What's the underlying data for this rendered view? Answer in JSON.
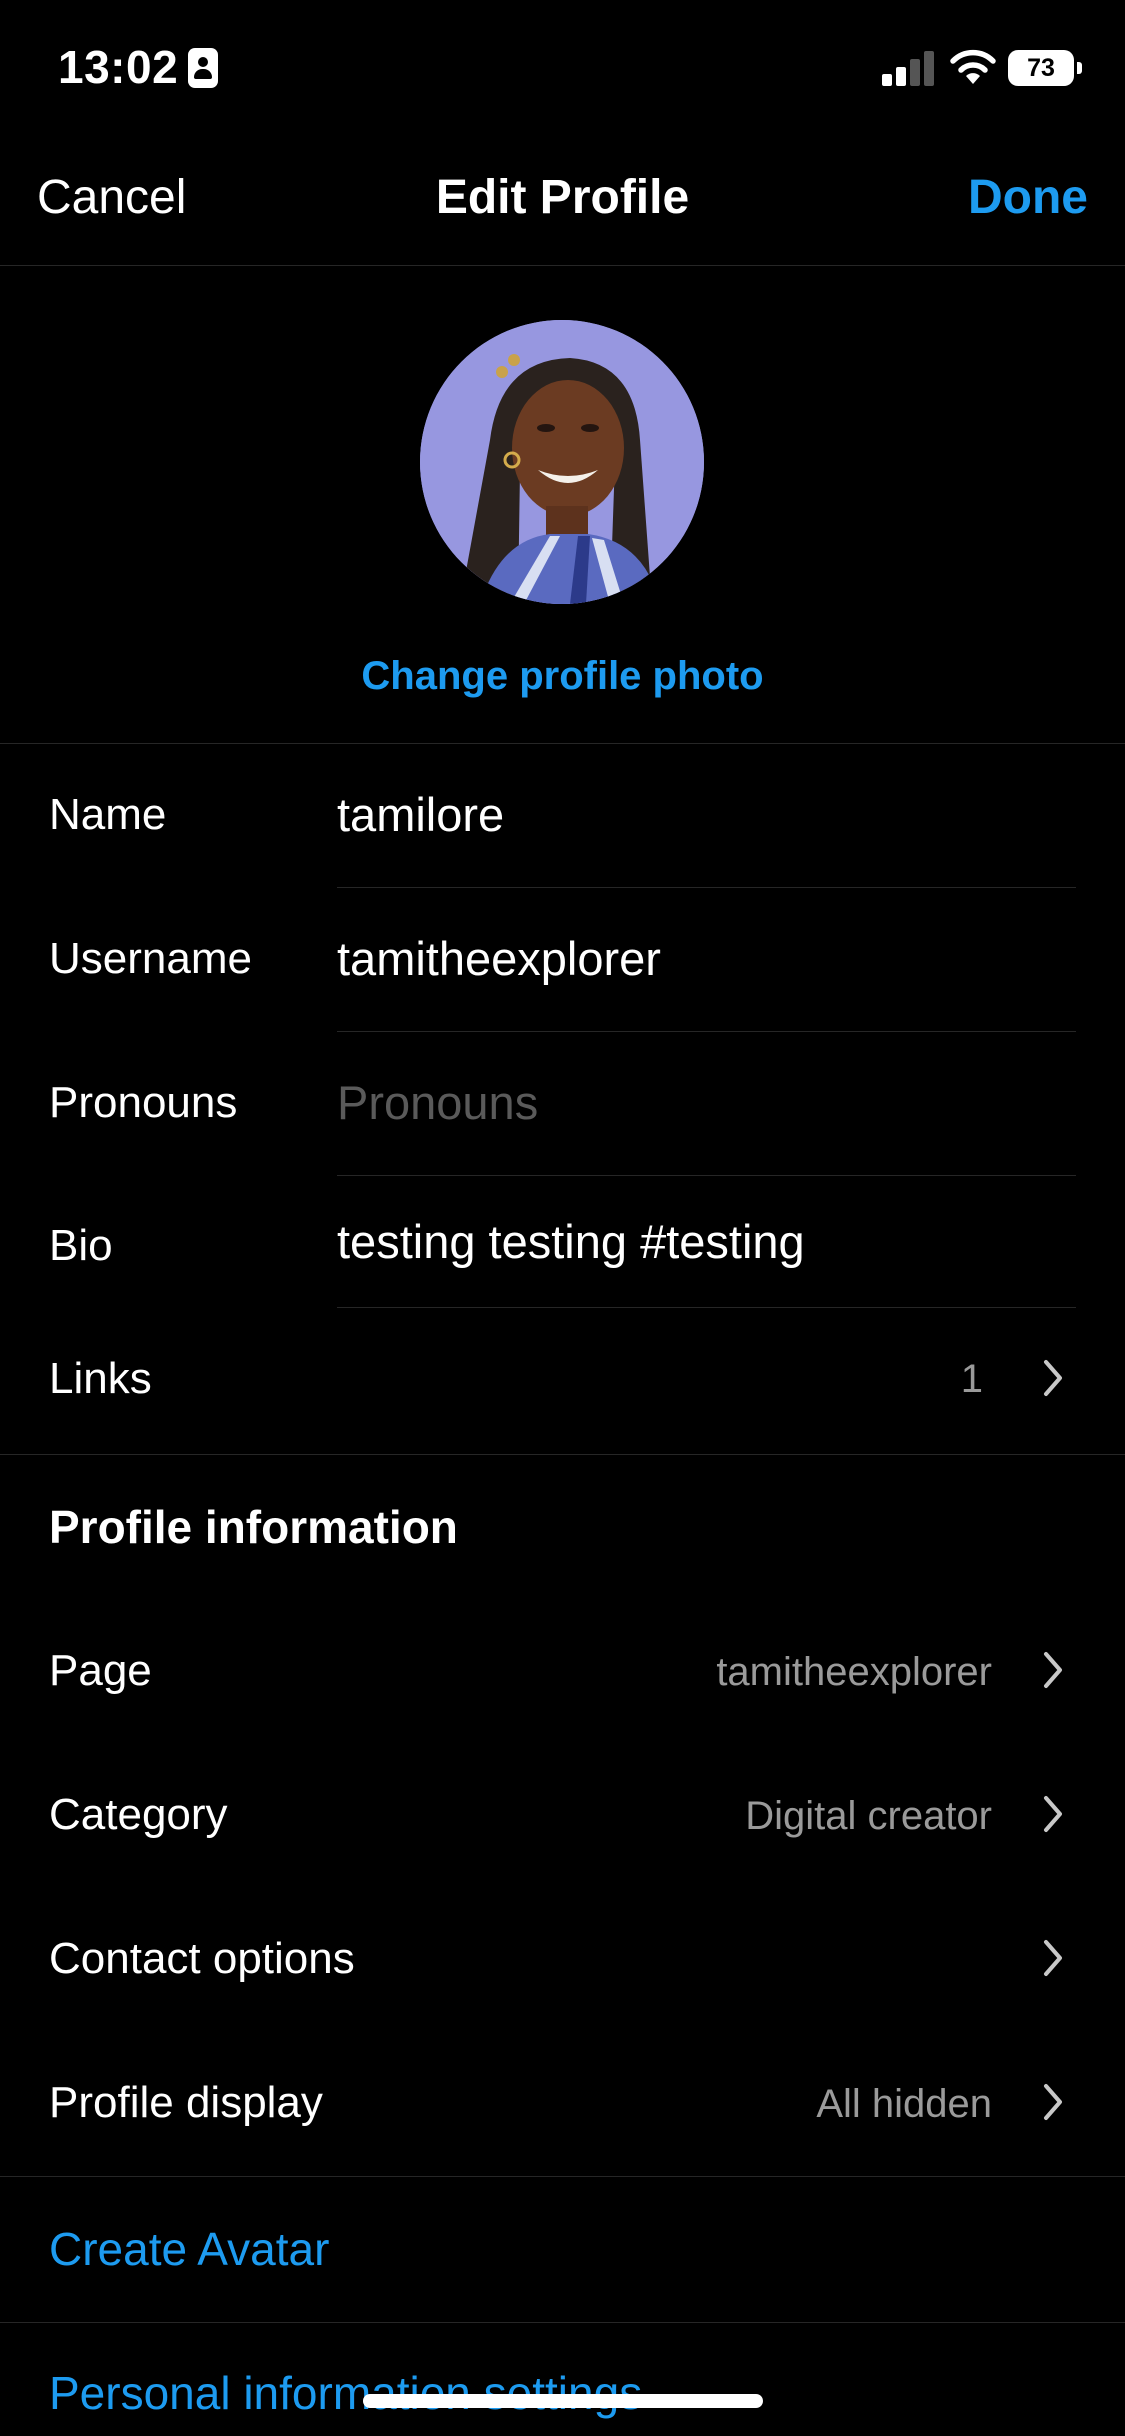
{
  "status_bar": {
    "time": "13:02",
    "battery": "73",
    "icons": [
      "id-card-icon",
      "cellular-signal-icon",
      "wifi-icon",
      "battery-icon"
    ]
  },
  "nav": {
    "cancel_label": "Cancel",
    "title": "Edit Profile",
    "done_label": "Done"
  },
  "profile_photo": {
    "change_label": "Change profile photo"
  },
  "fields": {
    "name": {
      "label": "Name",
      "value": "tamilore"
    },
    "username": {
      "label": "Username",
      "value": "tamitheexplorer"
    },
    "pronouns": {
      "label": "Pronouns",
      "placeholder": "Pronouns"
    },
    "bio": {
      "label": "Bio",
      "value": "testing testing #testing"
    },
    "links": {
      "label": "Links",
      "count": "1"
    }
  },
  "profile_information": {
    "heading": "Profile information",
    "items": [
      {
        "label": "Page",
        "value": "tamitheexplorer"
      },
      {
        "label": "Category",
        "value": "Digital creator"
      },
      {
        "label": "Contact options",
        "value": ""
      },
      {
        "label": "Profile display",
        "value": "All hidden"
      }
    ]
  },
  "links_section": {
    "create_avatar": "Create Avatar",
    "personal_info": "Personal information settings"
  },
  "colors": {
    "background": "#000000",
    "accent": "#1d9bf0",
    "separator": "#262626",
    "secondary_text": "#9a9a9a"
  }
}
